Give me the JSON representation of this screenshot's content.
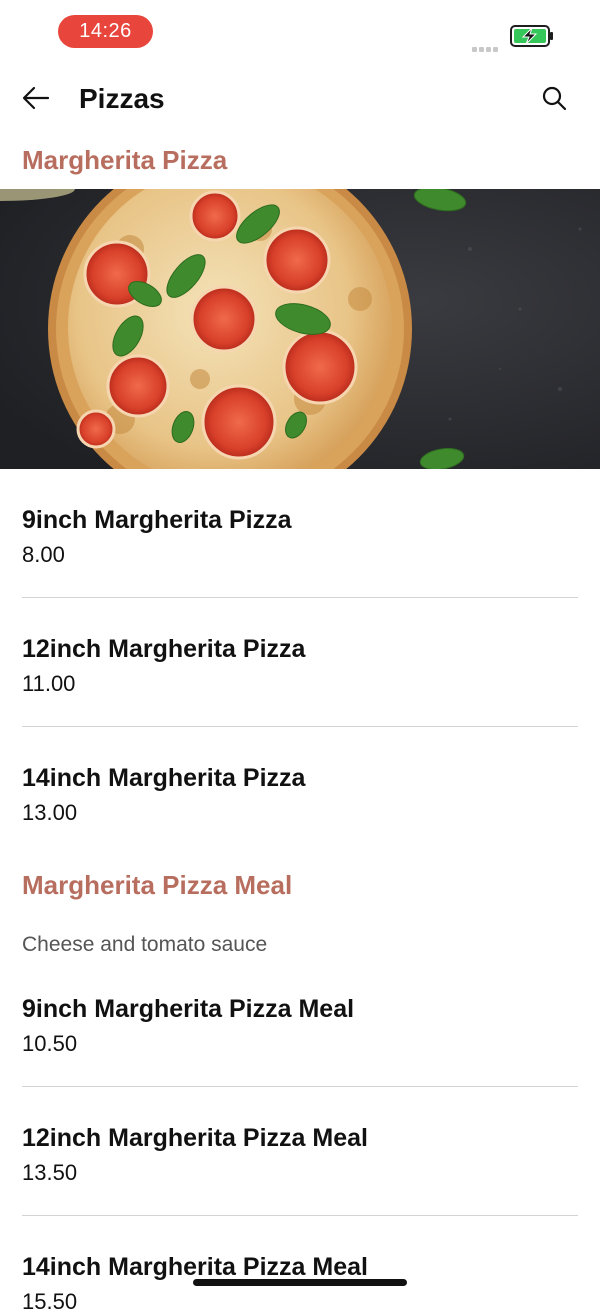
{
  "status_bar": {
    "time": "14:26",
    "battery_color": "#35c759",
    "time_pill_color": "#e8453c"
  },
  "app_bar": {
    "title": "Pizzas",
    "back_icon": "arrow-left-icon",
    "search_icon": "search-icon"
  },
  "accent_color": "#b86e5f",
  "categories": [
    {
      "title": "Margherita Pizza",
      "image": "margherita-pizza-photo",
      "items": [
        {
          "name": "9inch Margherita Pizza",
          "price": "8.00"
        },
        {
          "name": "12inch Margherita Pizza",
          "price": "11.00"
        },
        {
          "name": "14inch Margherita Pizza",
          "price": "13.00"
        }
      ]
    },
    {
      "title": "Margherita Pizza Meal",
      "description": "Cheese and tomato sauce",
      "items": [
        {
          "name": "9inch Margherita Pizza Meal",
          "price": "10.50"
        },
        {
          "name": "12inch Margherita Pizza Meal",
          "price": "13.50"
        },
        {
          "name": "14inch Margherita Pizza Meal",
          "price": "15.50"
        }
      ]
    }
  ]
}
